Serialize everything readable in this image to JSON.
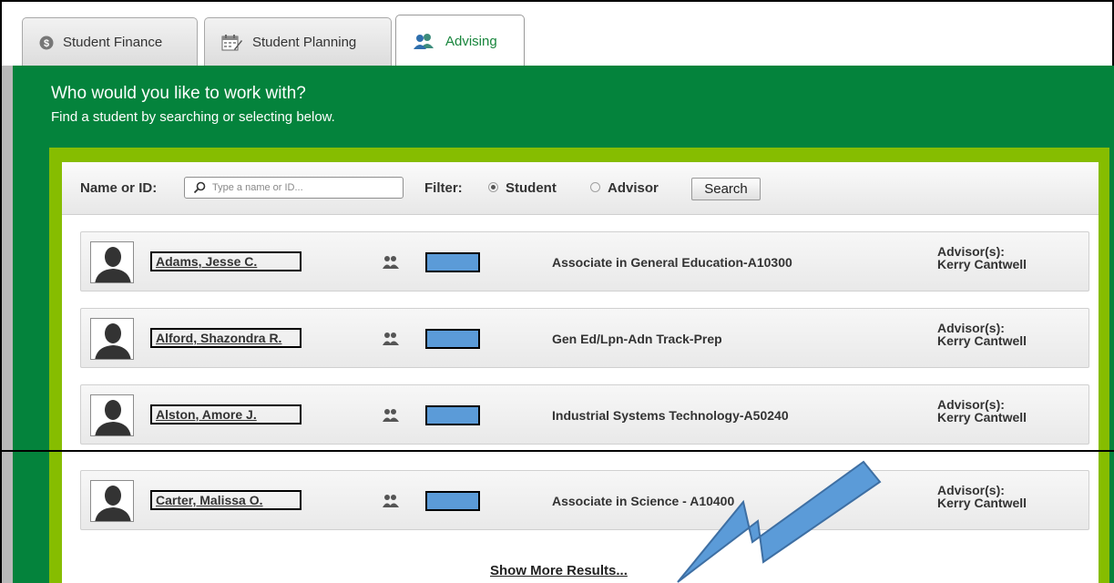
{
  "tabs": [
    {
      "label": "Student Finance",
      "icon": "dollar-coin-icon"
    },
    {
      "label": "Student Planning",
      "icon": "calendar-edit-icon"
    },
    {
      "label": "Advising",
      "icon": "people-icon",
      "active": true
    }
  ],
  "header": {
    "title": "Who would you like to work with?",
    "subtitle": "Find a student by searching or selecting below."
  },
  "search": {
    "label": "Name or ID:",
    "placeholder": "Type a name or ID...",
    "filter_label": "Filter:",
    "options": [
      "Student",
      "Advisor"
    ],
    "selected": "Student",
    "button_label": "Search"
  },
  "results": [
    {
      "name": "Adams, Jesse C.",
      "program": "Associate in General Education-A10300",
      "advisor_label": "Advisor(s):",
      "advisor": "Kerry Cantwell"
    },
    {
      "name": "Alford, Shazondra R.",
      "program": "Gen Ed/Lpn-Adn Track-Prep",
      "advisor_label": "Advisor(s):",
      "advisor": "Kerry Cantwell"
    },
    {
      "name": "Alston, Amore J.",
      "program": "Industrial Systems Technology-A50240",
      "advisor_label": "Advisor(s):",
      "advisor": "Kerry Cantwell"
    },
    {
      "name": "Carter, Malissa O.",
      "program": "Associate in Science - A10400",
      "advisor_label": "Advisor(s):",
      "advisor": "Kerry Cantwell"
    }
  ],
  "show_more_label": "Show More Results...",
  "colors": {
    "brand_green": "#04833c",
    "lime_border": "#86bd00",
    "redaction_blue": "#5b9bd8",
    "arrow_blue": "#5b9bd8"
  }
}
